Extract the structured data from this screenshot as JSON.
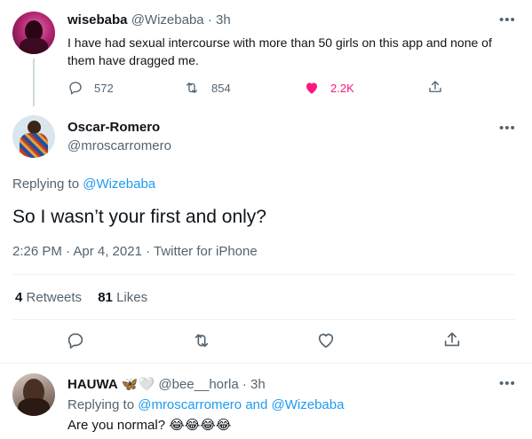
{
  "tweet1": {
    "name": "wisebaba",
    "handle": "@Wizebaba",
    "time": "· 3h",
    "text": "I have had sexual intercourse with more than 50 girls on this app and none of them have dragged me.",
    "replies": "572",
    "retweets": "854",
    "likes": "2.2K"
  },
  "tweet2": {
    "name": "Oscar-Romero",
    "handle": "@mroscarromero",
    "replying_prefix": "Replying to",
    "replying_to": "@Wizebaba",
    "text": "So I wasn’t your first and only?",
    "timestamp": "2:26 PM · Apr 4, 2021 · Twitter for iPhone",
    "retweets_count": "4",
    "retweets_label": "Retweets",
    "likes_count": "81",
    "likes_label": "Likes"
  },
  "tweet3": {
    "name": "HAUWA",
    "name_emoji": "🦋🤍",
    "handle": "@bee__horla",
    "time": "· 3h",
    "replying_prefix": "Replying to",
    "replying_to_1": "@mroscarromero",
    "replying_and": "and",
    "replying_to_2": "@Wizebaba",
    "text": "Are you normal?",
    "text_emoji": "😂😂😂😂"
  },
  "more_label": "•••",
  "colors": {
    "accent": "#1d9bf0",
    "like": "#f91880",
    "muted": "#536471"
  },
  "icons": [
    "reply-icon",
    "retweet-icon",
    "like-icon",
    "share-icon",
    "more-icon"
  ]
}
